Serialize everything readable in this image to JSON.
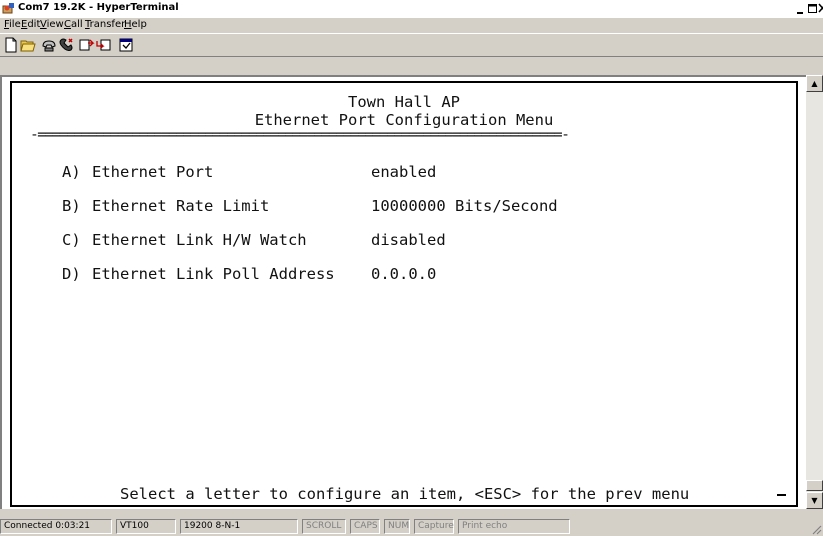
{
  "window": {
    "title": "Com7 19.2K - HyperTerminal"
  },
  "menu": [
    {
      "label": "File",
      "access": "F",
      "rest": "ile"
    },
    {
      "label": "Edit",
      "access": "E",
      "rest": "dit"
    },
    {
      "label": "View",
      "access": "V",
      "rest": "iew"
    },
    {
      "label": "Call",
      "access": "C",
      "rest": "all"
    },
    {
      "label": "Transfer",
      "access": "T",
      "rest": "ransfer"
    },
    {
      "label": "Help",
      "access": "H",
      "rest": "elp"
    }
  ],
  "toolbar": {
    "icons": [
      "new-document-icon",
      "open-folder-icon",
      "call-icon",
      "disconnect-icon",
      "send-icon",
      "receive-icon",
      "properties-icon"
    ]
  },
  "terminal": {
    "header1": "Town Hall AP",
    "header2": "Ethernet Port Configuration Menu",
    "separator": "-========================================================================-",
    "items": [
      {
        "key": "A)",
        "label": "Ethernet Port",
        "value": "enabled"
      },
      {
        "key": "B)",
        "label": "Ethernet Rate Limit",
        "value": "10000000 Bits/Second"
      },
      {
        "key": "C)",
        "label": "Ethernet Link H/W Watch",
        "value": "disabled"
      },
      {
        "key": "D)",
        "label": "Ethernet Link Poll Address",
        "value": "0.0.0.0"
      }
    ],
    "prompt": "Select a letter to configure an item, <ESC> for the prev menu"
  },
  "status": {
    "connected": "Connected 0:03:21",
    "emulation": "VT100",
    "settings": "19200 8-N-1",
    "scroll": "SCROLL",
    "caps": "CAPS",
    "num": "NUM",
    "capture": "Capture",
    "print_echo": "Print echo"
  },
  "colors": {
    "window_bg": "#d4d0c8",
    "terminal_bg": "#ffffff",
    "terminal_text": "#111111"
  }
}
